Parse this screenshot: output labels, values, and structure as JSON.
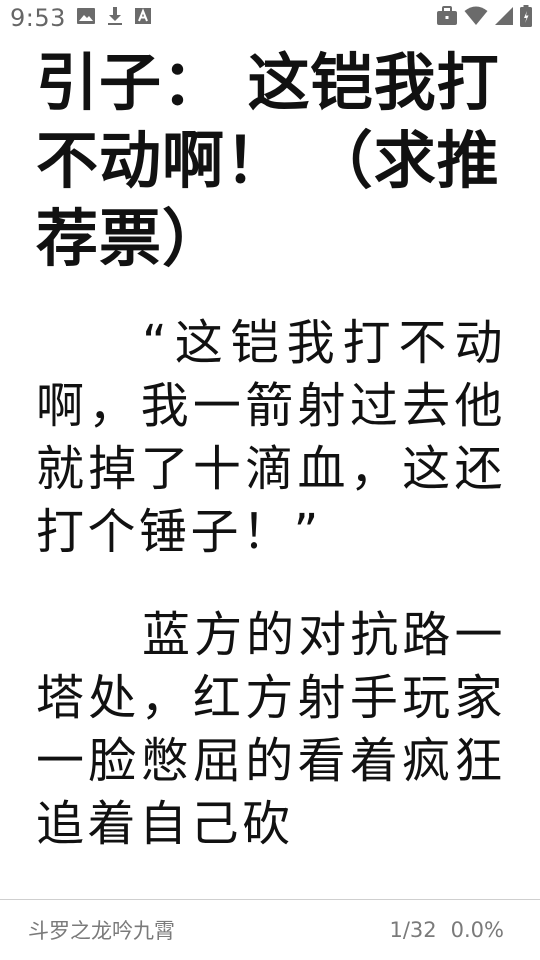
{
  "status_bar": {
    "time": "9:53",
    "icons_left": [
      "image-icon",
      "download-icon",
      "font-icon"
    ],
    "icons_right": [
      "briefcase-icon",
      "wifi-icon",
      "signal-icon",
      "battery-icon"
    ]
  },
  "reader": {
    "chapter_title": "引子： 这铠我打不动啊！ （求推荐票）",
    "paragraphs": [
      "“这铠我打不动啊，我一箭射过去他就掉了十滴血，这还打个锤子！”",
      "蓝方的对抗路一塔处，红方射手玩家一脸憋屈的看着疯狂追着自己砍"
    ]
  },
  "footer": {
    "book_title": "斗罗之龙吟九霄",
    "page_indicator": "1/32",
    "progress": "0.0%"
  }
}
